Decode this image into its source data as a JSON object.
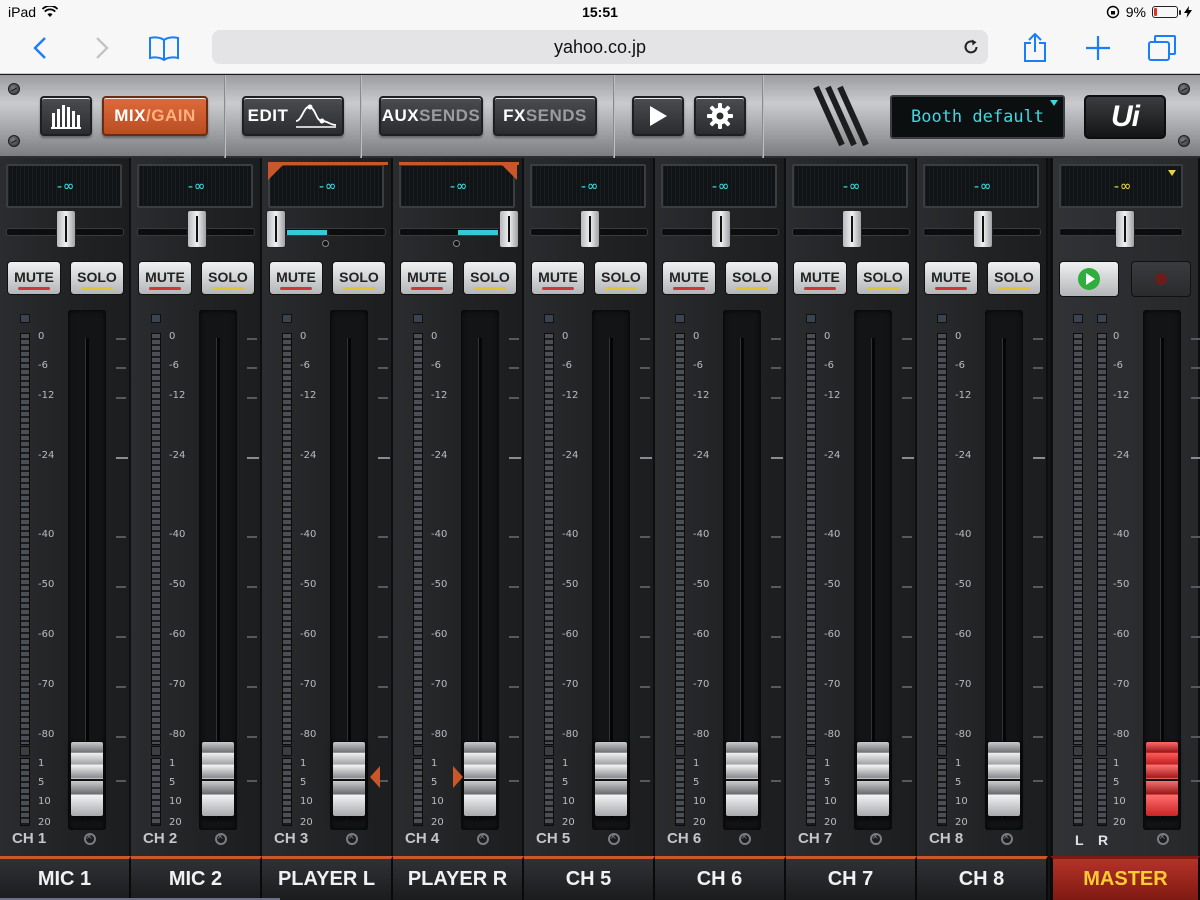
{
  "status_bar": {
    "device": "iPad",
    "time": "15:51",
    "battery_percent": "9%",
    "battery_level": 0.09
  },
  "browser": {
    "url": "yahoo.co.jp"
  },
  "toolbar": {
    "mix_label_main": "MIX",
    "mix_label_sep": "/",
    "mix_label_dim": "GAIN",
    "edit_label": "EDIT",
    "aux_main": "AUX",
    "aux_dim": "SENDS",
    "fx_main": "FX",
    "fx_dim": "SENDS",
    "preset": "Booth default",
    "logo": "Ui",
    "accent_color": "#c9572a",
    "display_color": "#3fd8e0"
  },
  "scale": {
    "upper": [
      "0",
      "-6",
      "-12",
      "-24",
      "-40",
      "-50",
      "-60",
      "-70",
      "-80"
    ],
    "lower": [
      "1",
      "5",
      "10",
      "20"
    ]
  },
  "buttons": {
    "mute": "MUTE",
    "solo": "SOLO"
  },
  "channels": [
    {
      "id": "CH 1",
      "name": "MIC 1",
      "gain": "-∞",
      "pan": "center",
      "linked": false
    },
    {
      "id": "CH 2",
      "name": "MIC 2",
      "gain": "-∞",
      "pan": "center",
      "linked": false
    },
    {
      "id": "CH 3",
      "name": "PLAYER L",
      "gain": "-∞",
      "pan": "hard-left",
      "linked": true
    },
    {
      "id": "CH 4",
      "name": "PLAYER R",
      "gain": "-∞",
      "pan": "hard-right",
      "linked": true
    },
    {
      "id": "CH 5",
      "name": "CH 5",
      "gain": "-∞",
      "pan": "center",
      "linked": false
    },
    {
      "id": "CH 6",
      "name": "CH 6",
      "gain": "-∞",
      "pan": "center",
      "linked": false
    },
    {
      "id": "CH 7",
      "name": "CH 7",
      "gain": "-∞",
      "pan": "center",
      "linked": false
    },
    {
      "id": "CH 8",
      "name": "CH 8",
      "gain": "-∞",
      "pan": "center",
      "linked": false
    }
  ],
  "master": {
    "name": "MASTER",
    "gain": "-∞",
    "left_label": "L",
    "right_label": "R",
    "name_color": "#ffcc33"
  }
}
